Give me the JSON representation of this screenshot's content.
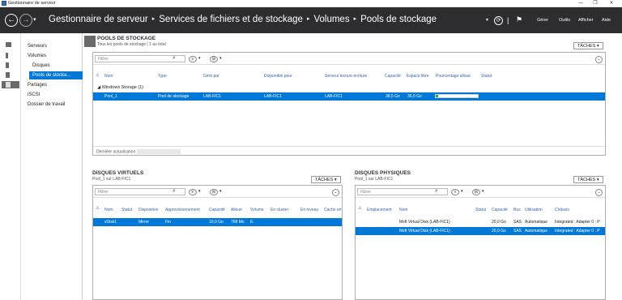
{
  "window": {
    "title": "Gestionnaire de serveur",
    "min": "—",
    "max": "❐",
    "close": "✕"
  },
  "header": {
    "back": "←",
    "forward": "→",
    "dropdown": "▾",
    "crumbs": [
      "Gestionnaire de serveur",
      "Services de fichiers et de stockage",
      "Volumes",
      "Pools de stockage"
    ],
    "separator": "▸",
    "refresh": "⟳",
    "divider": "|",
    "flag": "⚑",
    "menu": [
      "Gérer",
      "Outils",
      "Afficher",
      "Aide"
    ]
  },
  "nav": {
    "items": [
      "Serveurs",
      "Volumes",
      "Disques",
      "Pools de stocka...",
      "Partages",
      "iSCSI",
      "Dossier de travail"
    ]
  },
  "pools": {
    "title": "POOLS DE STOCKAGE",
    "subtitle": "Tous les pools de stockage | 1 au total",
    "tasks": "TÂCHES ▾",
    "filter_placeholder": "Filtrer",
    "columns": [
      "Nom",
      "Type",
      "Géré par",
      "Disponible pour",
      "Serveur lecture-écriture",
      "Capacité",
      "Espace libre",
      "Pourcentage alloué",
      "Statut"
    ],
    "group": "Windows Storage (1)",
    "row": {
      "name": "Pool_1",
      "type": "Pool de stockage",
      "managed": "LAB-FIC1",
      "available": "LAB-FIC1",
      "server": "LAB-FIC1",
      "capacity": "38,5 Go",
      "free": "36,0 Go",
      "allocated_pct": 6
    },
    "status": "Dernière actualisation"
  },
  "vdisks": {
    "title": "DISQUES VIRTUELS",
    "subtitle": "Pool_1 sur LAB-FIC1",
    "tasks": "TÂCHES ▾",
    "filter_placeholder": "Filtrer",
    "columns": [
      "Nom",
      "Statut",
      "Disposition",
      "Approvisionnement",
      "Capacité",
      "Alloué",
      "Volume",
      "En cluster",
      "En niveau",
      "Cache en"
    ],
    "row": {
      "name": "vDisk1",
      "layout": "Mirror",
      "provisioning": "Fin",
      "capacity": "10,0 Go",
      "allocated": "768 Mo",
      "volume": "E:"
    }
  },
  "pdisks": {
    "title": "DISQUES PHYSIQUES",
    "subtitle": "Pool_1 sur LAB-FIC1",
    "tasks": "TÂCHES ▾",
    "filter_placeholder": "Filtrer",
    "columns": [
      "Emplacement",
      "Nom",
      "Statut",
      "Capacité",
      "Bus",
      "Utilisation",
      "Châssis"
    ],
    "rows": [
      {
        "name": "Msft Virtual Disk (LAB-FIC1)",
        "capacity": "20,0 Go",
        "bus": "SAS",
        "usage": "Automatique",
        "chassis": "Integrated : Adapter 0 : P"
      },
      {
        "name": "Msft Virtual Disk (LAB-FIC1)",
        "capacity": "20,0 Go",
        "bus": "SAS",
        "usage": "Automatique",
        "chassis": "Integrated : Adapter 0 : P"
      }
    ]
  },
  "icons": {
    "search": "⌕",
    "expand": "⌄",
    "warning": "⚠"
  }
}
